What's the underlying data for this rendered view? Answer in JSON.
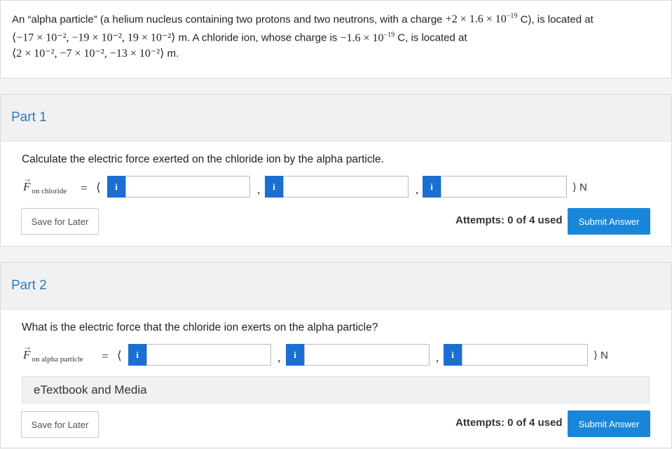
{
  "question": {
    "line1_a": "An “alpha particle” (a helium nucleus containing two protons and two neutrons, with a charge ",
    "charge_alpha": "+2 × 1.6 × 10",
    "charge_alpha_exp": "−19",
    "line1_b": " C), is located at",
    "pos_alpha": "⟨−17 × 10⁻², −19 × 10⁻², 19 × 10⁻²⟩",
    "line2_b": " m. A chloride ion, whose charge is ",
    "charge_cl": "−1.6 × 10",
    "charge_cl_exp": "−19",
    "line2_c": " C, is located at",
    "pos_cl": "⟨2 × 10⁻², −7 × 10⁻², −13 × 10⁻²⟩",
    "line3_b": " m."
  },
  "part1": {
    "title": "Part 1",
    "prompt": "Calculate the electric force exerted on the chloride ion by the alpha particle.",
    "vector_symbol": "F",
    "vector_sub": "on chloride",
    "equals": "=",
    "open": "⟨",
    "info_label": "i",
    "comma": ",",
    "close": "⟩ N",
    "inputs": [
      "",
      "",
      ""
    ],
    "save_label": "Save for Later",
    "attempts": "Attempts: 0 of 4 used",
    "submit_label": "Submit Answer"
  },
  "part2": {
    "title": "Part 2",
    "prompt": "What is the electric force that the chloride ion exerts on the alpha particle?",
    "vector_symbol": "F",
    "vector_sub": "on alpha particle",
    "equals": "=",
    "open": "⟨",
    "info_label": "i",
    "comma": ",",
    "close": "⟩ N",
    "inputs": [
      "",
      "",
      ""
    ],
    "etextbook": "eTextbook and Media",
    "save_label": "Save for Later",
    "attempts": "Attempts: 0 of 4 used",
    "submit_label": "Submit Answer"
  }
}
